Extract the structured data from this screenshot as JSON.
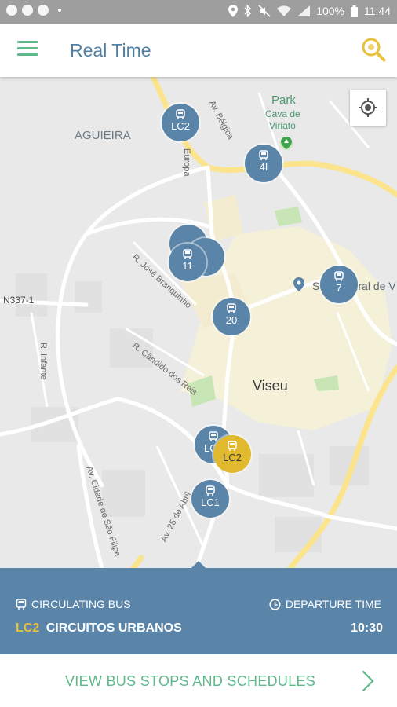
{
  "status_bar": {
    "battery": "100%",
    "time": "11:44"
  },
  "app_bar": {
    "title": "Real Time"
  },
  "map": {
    "place_labels": {
      "aguieira": "AGUIEIRA",
      "park": "Park",
      "park_sub1": "Cava de",
      "park_sub2": "Viriato",
      "viseu": "Viseu",
      "road_n337": "N337-1",
      "poi_se": "Sé Catedral de V"
    },
    "street_labels": {
      "belgica": "Av. Bélgica",
      "europa": "Europa",
      "jose_branquinho": "R. José Branquinho",
      "candido_reis": "R. Cândido dos Reis",
      "sao_filipe": "Av. Cidade de São Filipe",
      "vinte_cinco_abril": "Av. 25 de Abril",
      "infante": "R. Infante"
    },
    "markers": [
      {
        "id": "lc2-top",
        "label": "LC2",
        "active": false
      },
      {
        "id": "41",
        "label": "4I",
        "active": false
      },
      {
        "id": "11",
        "label": "11",
        "active": false
      },
      {
        "id": "7",
        "label": "7",
        "active": false
      },
      {
        "id": "20",
        "label": "20",
        "active": false
      },
      {
        "id": "lc-partial",
        "label": "LC",
        "active": false
      },
      {
        "id": "lc2-selected",
        "label": "LC2",
        "active": true
      },
      {
        "id": "lc1",
        "label": "LC1",
        "active": false
      }
    ]
  },
  "panel": {
    "circulating_label": "CIRCULATING BUS",
    "departure_label": "DEPARTURE TIME",
    "route_code": "LC2",
    "route_name": "CIRCUITOS URBANOS",
    "departure_time": "10:30"
  },
  "action": {
    "label": "VIEW BUS STOPS AND SCHEDULES"
  },
  "colors": {
    "accent_green": "#5db88a",
    "primary_blue": "#5b85a8",
    "title_blue": "#4f7fa3",
    "active_yellow": "#e0b92e",
    "search_yellow": "#e8c23a"
  }
}
